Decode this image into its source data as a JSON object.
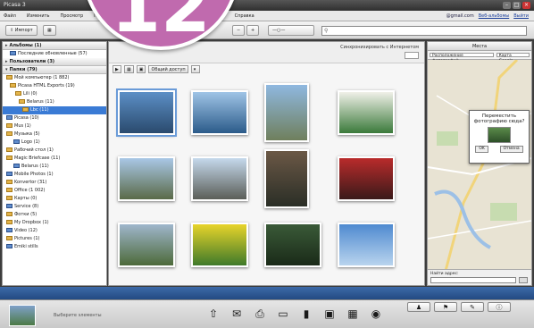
{
  "window": {
    "title": "Picasa 3"
  },
  "menu": {
    "items": [
      "Файл",
      "Изменить",
      "Просмотр",
      "Папка",
      "Изображение",
      "Создать",
      "Инструменты",
      "Справка"
    ],
    "user_email": "@gmail.com",
    "user_links": [
      "Веб-альбомы",
      "Выйти"
    ]
  },
  "toolbar": {
    "import_label": "Импорт",
    "search_placeholder": ""
  },
  "badge": {
    "number": "12"
  },
  "left_panel": {
    "sections": [
      {
        "label": "Альбомы (1)"
      },
      {
        "label": "Пользователи (3)"
      },
      {
        "label": "Папки (79)"
      }
    ],
    "items": [
      {
        "label": "Последние обновленные (57)",
        "indent": 8,
        "type": "pi",
        "selected": false
      },
      {
        "label": "Мой компьютер (1 882)",
        "indent": 4,
        "type": "fi",
        "selected": false
      },
      {
        "label": "Picasa HTML Exports (19)",
        "indent": 8,
        "type": "fi",
        "selected": false
      },
      {
        "label": "Lili (0)",
        "indent": 14,
        "type": "fi",
        "selected": false
      },
      {
        "label": "Belarus (11)",
        "indent": 18,
        "type": "fi",
        "selected": false
      },
      {
        "label": "Lbc (11)",
        "indent": 22,
        "type": "fi",
        "selected": true
      },
      {
        "label": "Picasa (10)",
        "indent": 4,
        "type": "pi",
        "selected": false
      },
      {
        "label": "Mus (1)",
        "indent": 4,
        "type": "fi",
        "selected": false
      },
      {
        "label": "Музыка (5)",
        "indent": 4,
        "type": "fi",
        "selected": false
      },
      {
        "label": "Logo (1)",
        "indent": 12,
        "type": "pi",
        "selected": false
      },
      {
        "label": "Рабочий стол (1)",
        "indent": 4,
        "type": "fi",
        "selected": false
      },
      {
        "label": "Magic Briefcase (11)",
        "indent": 4,
        "type": "fi",
        "selected": false
      },
      {
        "label": "Belarus (11)",
        "indent": 12,
        "type": "pi",
        "selected": false
      },
      {
        "label": "Mobile Photos (1)",
        "indent": 4,
        "type": "pi",
        "selected": false
      },
      {
        "label": "Konvertor (31)",
        "indent": 4,
        "type": "fi",
        "selected": false
      },
      {
        "label": "Office (1 002)",
        "indent": 4,
        "type": "fi",
        "selected": false
      },
      {
        "label": "Карты (0)",
        "indent": 4,
        "type": "fi",
        "selected": false
      },
      {
        "label": "Service (8)",
        "indent": 4,
        "type": "pi",
        "selected": false
      },
      {
        "label": "Фотки (5)",
        "indent": 4,
        "type": "fi",
        "selected": false
      },
      {
        "label": "My Dropbox (1)",
        "indent": 4,
        "type": "fi",
        "selected": false
      },
      {
        "label": "Video (12)",
        "indent": 4,
        "type": "pi",
        "selected": false
      },
      {
        "label": "Pictures (1)",
        "indent": 4,
        "type": "fi",
        "selected": false
      },
      {
        "label": "Emiki stills",
        "indent": 4,
        "type": "pi",
        "selected": false
      }
    ]
  },
  "center": {
    "right_link": "Синхронизировать с Интернетом",
    "action_button": "Общий доступ",
    "photos": [
      {
        "colors": [
          "#5c8fc6",
          "#2a4a6d"
        ]
      },
      {
        "colors": [
          "#9fc4e6",
          "#2b5b8a"
        ]
      },
      {
        "colors": [
          "#8fb8e0",
          "#6f7f5c"
        ]
      },
      {
        "colors": [
          "#f0f0e8",
          "#3b7a3b"
        ]
      },
      {
        "colors": [
          "#a9c7e6",
          "#5a6a48"
        ]
      },
      {
        "colors": [
          "#c5d9ec",
          "#5b5e58"
        ]
      },
      {
        "colors": [
          "#6b5846",
          "#2a2e26"
        ]
      },
      {
        "colors": [
          "#b92b2b",
          "#3a1a1a"
        ]
      },
      {
        "colors": [
          "#9fb6cc",
          "#4d6a3a"
        ]
      },
      {
        "colors": [
          "#e8d42a",
          "#3f7a2a"
        ]
      },
      {
        "colors": [
          "#3a5a38",
          "#1a2a18"
        ]
      },
      {
        "colors": [
          "#4f8ad0",
          "#b9d4ee"
        ]
      }
    ]
  },
  "right_panel": {
    "title": "Места",
    "tabs": [
      "Расположение фотографий",
      "Карта Google"
    ],
    "dialog": {
      "question": "Переместить фотографию сюда?",
      "ok": "OK",
      "cancel": "Отмена"
    },
    "footer_label": "Найти адрес:"
  },
  "bottom": {
    "status": "Выберите элементы"
  }
}
